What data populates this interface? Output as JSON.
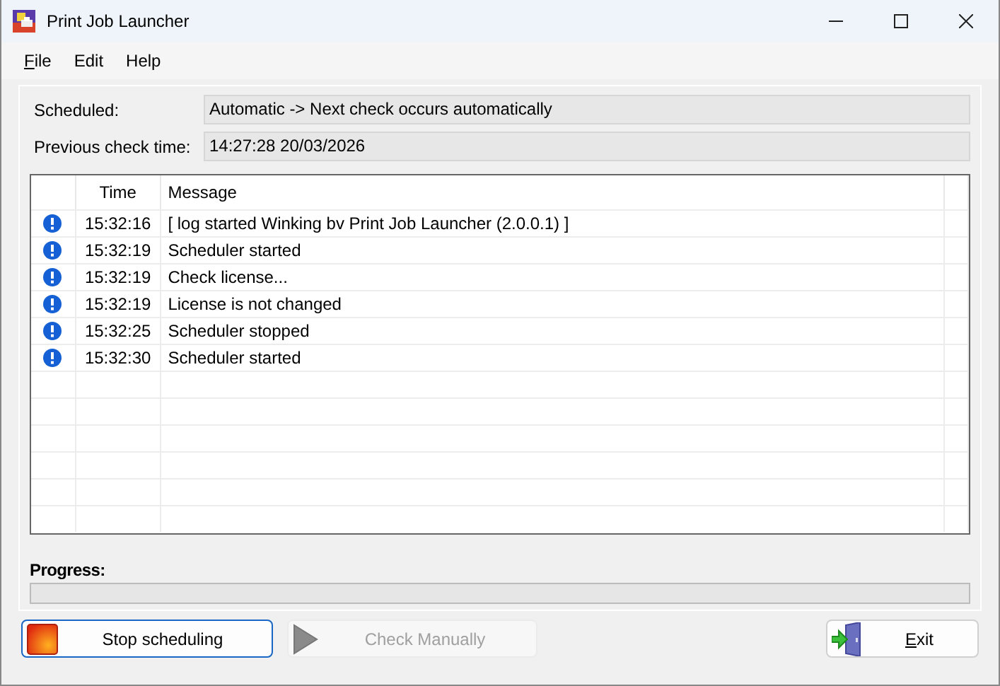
{
  "window": {
    "title": "Print Job Launcher"
  },
  "menu": [
    {
      "label": "File",
      "underline_first": true
    },
    {
      "label": "Edit"
    },
    {
      "label": "Help"
    }
  ],
  "fields": [
    {
      "label": "Scheduled:",
      "value": "Automatic -> Next check occurs automatically"
    },
    {
      "label": "Previous check time:",
      "value": "14:27:28 20/03/2026"
    }
  ],
  "log": {
    "columns": [
      "Time",
      "Message"
    ],
    "rows": [
      {
        "kind": "info",
        "time": "15:32:16",
        "message": "[ log started Winking bv Print Job Launcher (2.0.0.1) ]"
      },
      {
        "kind": "info",
        "time": "15:32:19",
        "message": "Scheduler started"
      },
      {
        "kind": "info",
        "time": "15:32:19",
        "message": "Check license..."
      },
      {
        "kind": "info",
        "time": "15:32:19",
        "message": "License is not changed"
      },
      {
        "kind": "info",
        "time": "15:32:25",
        "message": "Scheduler stopped"
      },
      {
        "kind": "info",
        "time": "15:32:30",
        "message": "Scheduler started"
      }
    ]
  },
  "progress": {
    "label": "Progress:",
    "level": 0
  },
  "buttons": [
    {
      "kind": "stop",
      "label": "Stop scheduling",
      "disabled": false,
      "focused": true
    },
    {
      "kind": "play",
      "label": "Check Manually",
      "disabled": true,
      "focused": false
    },
    {
      "kind": "exit",
      "label": "Exit",
      "underline_first": true,
      "disabled": false,
      "focused": false
    }
  ]
}
